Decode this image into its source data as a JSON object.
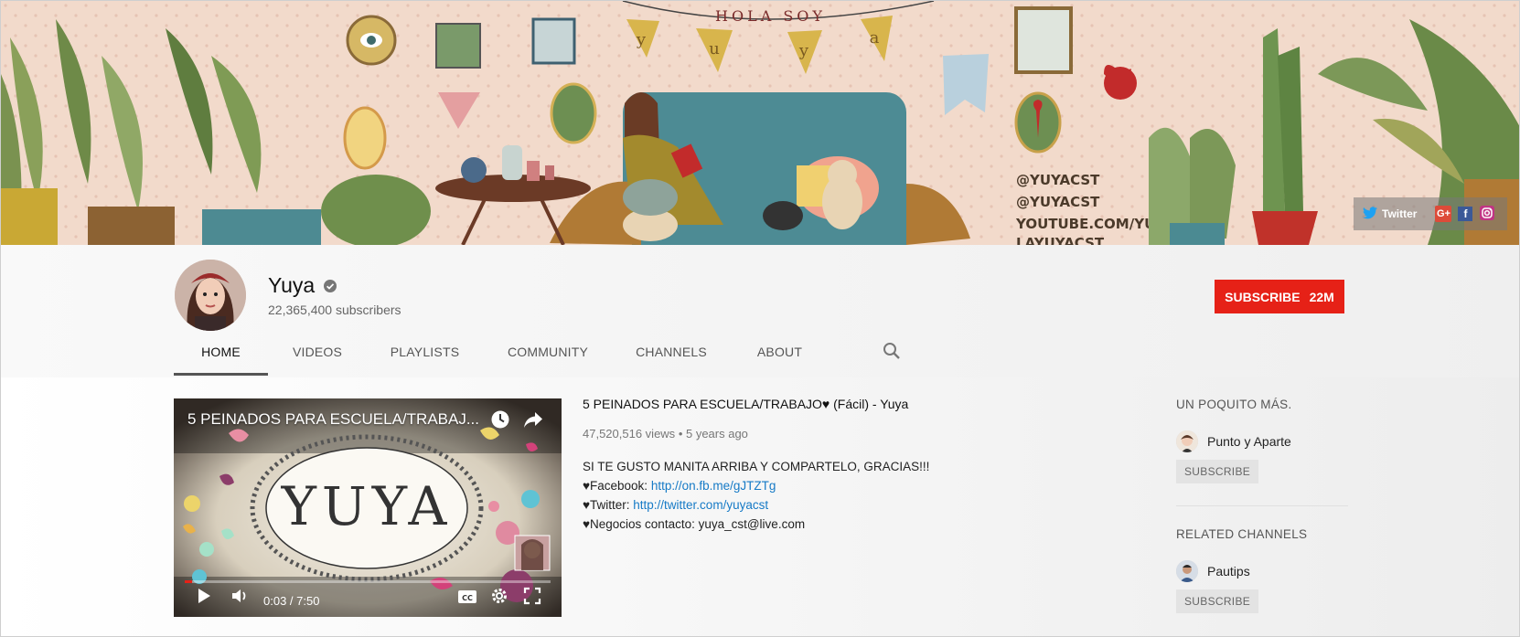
{
  "banner": {
    "hola_soy": "HOLA SOY",
    "bunting_letters": [
      "y",
      "u",
      "y",
      "a"
    ],
    "handles": [
      "@YUYACST",
      "@YUYACST",
      "YOUTUBE.COM/YUYA",
      "LAYUYACST"
    ],
    "social_links": {
      "twitter_label": "Twitter",
      "gplus_label": "G+",
      "facebook_label": "f"
    }
  },
  "channel": {
    "name": "Yuya",
    "subscribers": "22,365,400 subscribers",
    "subscribe_label": "SUBSCRIBE",
    "subscribe_count": "22M"
  },
  "tabs": [
    {
      "label": "HOME",
      "active": true
    },
    {
      "label": "VIDEOS",
      "active": false
    },
    {
      "label": "PLAYLISTS",
      "active": false
    },
    {
      "label": "COMMUNITY",
      "active": false
    },
    {
      "label": "CHANNELS",
      "active": false
    },
    {
      "label": "ABOUT",
      "active": false
    }
  ],
  "featured_video": {
    "overlay_title": "5 PEINADOS PARA ESCUELA/TRABAJ...",
    "thumbnail_logo": "YUYA",
    "time": "0:03 / 7:50",
    "progress": 0.0064,
    "title": "5 PEINADOS PARA ESCUELA/TRABAJO♥ (Fácil) - Yuya",
    "views": "47,520,516 views",
    "age": "5 years ago",
    "description": {
      "line1": "SI TE GUSTO MANITA ARRIBA Y COMPARTELO, GRACIAS!!!",
      "facebook_prefix": "♥Facebook: ",
      "facebook_link": "http://on.fb.me/gJTZTg",
      "twitter_prefix": "♥Twitter: ",
      "twitter_link": "http://twitter.com/yuyacst",
      "business": "♥Negocios contacto: yuya_cst@live.com"
    }
  },
  "sidebar": {
    "section1_heading": "UN POQUITO MÁS.",
    "section1_channel": "Punto y Aparte",
    "section2_heading": "RELATED CHANNELS",
    "section2_channel": "Pautips",
    "subscribe_label": "SUBSCRIBE"
  },
  "colors": {
    "subscribe_red": "#e62117",
    "link_blue": "#167ac6",
    "banner_bg": "#f1d8c9"
  }
}
